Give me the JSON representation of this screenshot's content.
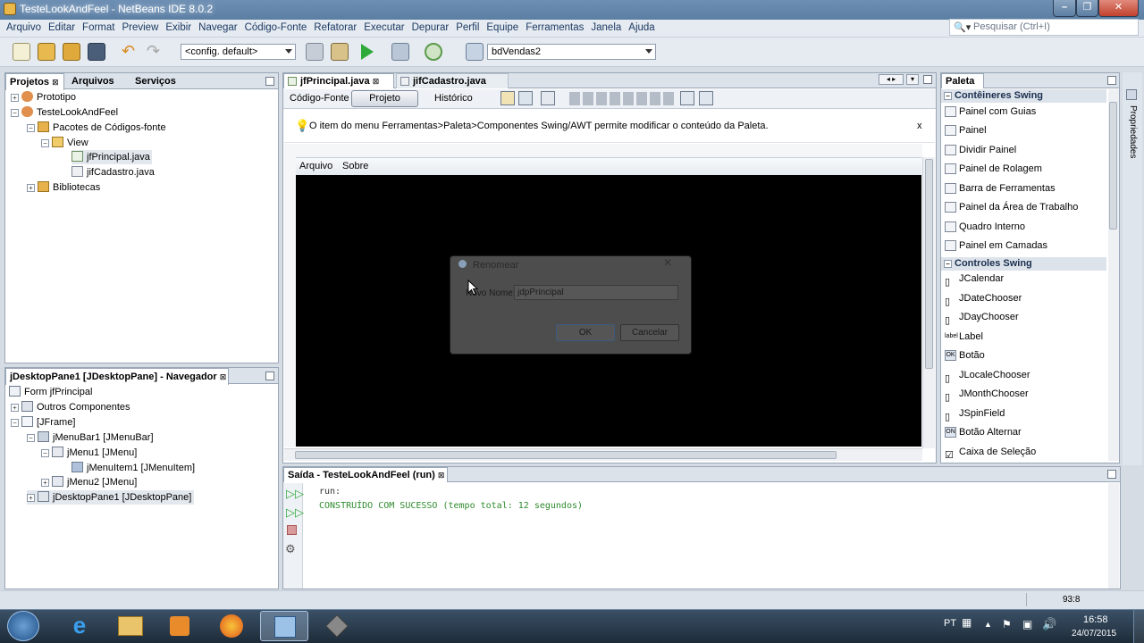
{
  "window": {
    "title": "TesteLookAndFeel - NetBeans IDE 8.0.2"
  },
  "menu": [
    "Arquivo",
    "Editar",
    "Format",
    "Preview",
    "Exibir",
    "Navegar",
    "Código-Fonte",
    "Refatorar",
    "Executar",
    "Depurar",
    "Perfil",
    "Equipe",
    "Ferramentas",
    "Janela",
    "Ajuda"
  ],
  "search": {
    "placeholder": "Pesquisar (Ctrl+I)"
  },
  "toolbar": {
    "config_combo": "<config. default>",
    "project_combo": "bdVendas2"
  },
  "projects_panel": {
    "tabs": [
      "Projetos",
      "Arquivos",
      "Serviços"
    ],
    "tree": [
      {
        "label": "Prototipo",
        "indent": 0
      },
      {
        "label": "TesteLookAndFeel",
        "indent": 0
      },
      {
        "label": "Pacotes de Códigos-fonte",
        "indent": 1
      },
      {
        "label": "View",
        "indent": 2
      },
      {
        "label": "jfPrincipal.java",
        "indent": 3
      },
      {
        "label": "jifCadastro.java",
        "indent": 3
      },
      {
        "label": "Bibliotecas",
        "indent": 1
      }
    ]
  },
  "navigator_panel": {
    "title": "jDesktopPane1 [JDesktopPane] - Navegador",
    "tree": [
      {
        "label": "Form jfPrincipal"
      },
      {
        "label": "Outros Componentes"
      },
      {
        "label": "[JFrame]"
      },
      {
        "label": "jMenuBar1 [JMenuBar]"
      },
      {
        "label": "jMenu1 [JMenu]"
      },
      {
        "label": "jMenuItem1 [JMenuItem]"
      },
      {
        "label": "jMenu2 [JMenu]"
      },
      {
        "label": "jDesktopPane1 [JDesktopPane]"
      }
    ]
  },
  "editor": {
    "tabs": [
      "jfPrincipal.java",
      "jifCadastro.java"
    ],
    "view_tabs": [
      "Código-Fonte",
      "Projeto",
      "Histórico"
    ],
    "hint": "O item do menu Ferramentas>Paleta>Componentes Swing/AWT permite modificar o conteúdo da Paleta.",
    "hint_close": "x",
    "form_menu": [
      "Arquivo",
      "Sobre"
    ],
    "dialog": {
      "title": "Renomear",
      "label": "Novo Nome:",
      "value": "jdpPrincipal",
      "ok": "OK",
      "cancel": "Cancelar"
    }
  },
  "palette": {
    "title": "Paleta",
    "side_label": "Propriedades",
    "categories": [
      {
        "name": "Contêineres Swing",
        "items": [
          "Painel com Guias",
          "Painel",
          "Dividir Painel",
          "Painel de Rolagem",
          "Barra de Ferramentas",
          "Painel da Área de Trabalho",
          "Quadro Interno",
          "Painel em Camadas"
        ]
      },
      {
        "name": "Controles Swing",
        "items": [
          "JCalendar",
          "JDateChooser",
          "JDayChooser",
          "Label",
          "Botão",
          "JLocaleChooser",
          "JMonthChooser",
          "JSpinField",
          "Botão Alternar",
          "Caixa de Seleção"
        ]
      }
    ],
    "icon_labels": {
      "label": "label",
      "button": "OK",
      "toggle": "ON"
    }
  },
  "output": {
    "title": "Saída - TesteLookAndFeel (run)",
    "lines": [
      "run:",
      "CONSTRUÍDO COM SUCESSO (tempo total: 12 segundos)"
    ]
  },
  "status": {
    "position": "93:8"
  },
  "taskbar": {
    "lang": "PT",
    "time": "16:58",
    "date": "24/07/2015"
  },
  "colors": {
    "success_text": "#2e8b2e",
    "title_bar": "#6d8fb3"
  }
}
